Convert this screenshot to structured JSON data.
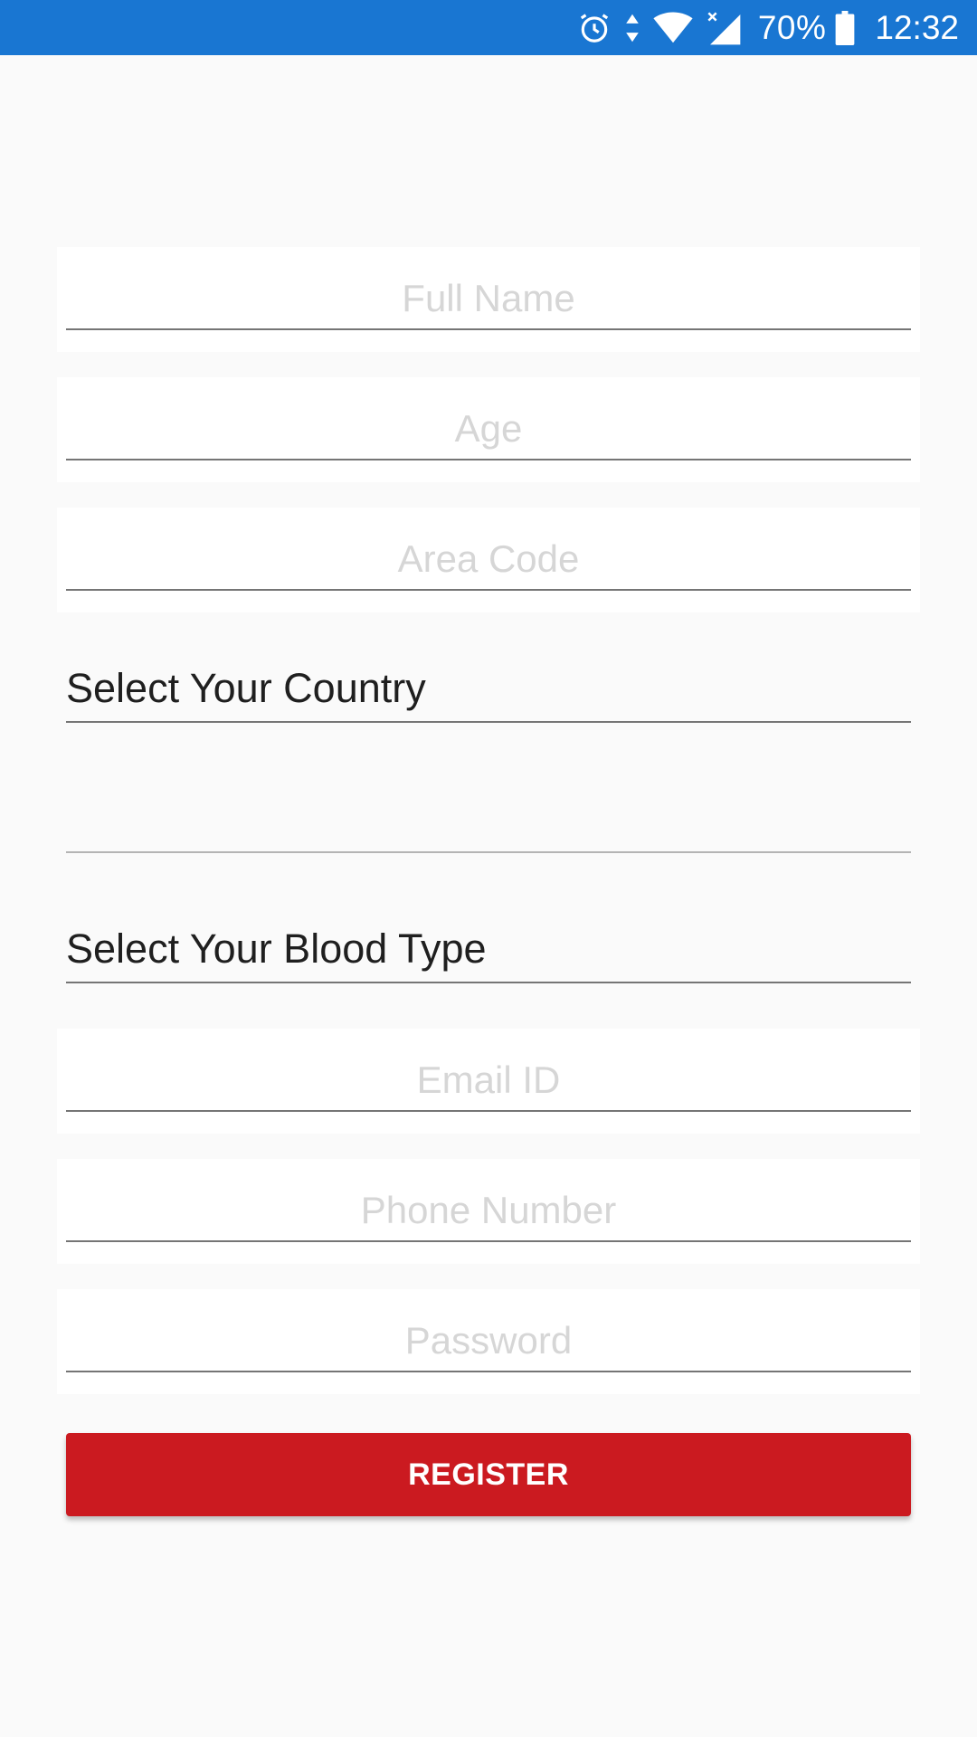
{
  "status_bar": {
    "battery": "70%",
    "time": "12:32",
    "icons": [
      "alarm-icon",
      "data-arrows-icon",
      "wifi-icon",
      "cell-signal-icon",
      "battery-icon"
    ],
    "background_color": "#1976d2"
  },
  "form": {
    "full_name_placeholder": "Full Name",
    "age_placeholder": "Age",
    "area_code_placeholder": "Area Code",
    "country_picker": "Select Your Country",
    "blood_type_picker": "Select Your Blood Type",
    "email_placeholder": "Email ID",
    "phone_placeholder": "Phone Number",
    "password_placeholder": "Password",
    "register_label": "REGISTER",
    "accent_color": "#cb1a20"
  }
}
